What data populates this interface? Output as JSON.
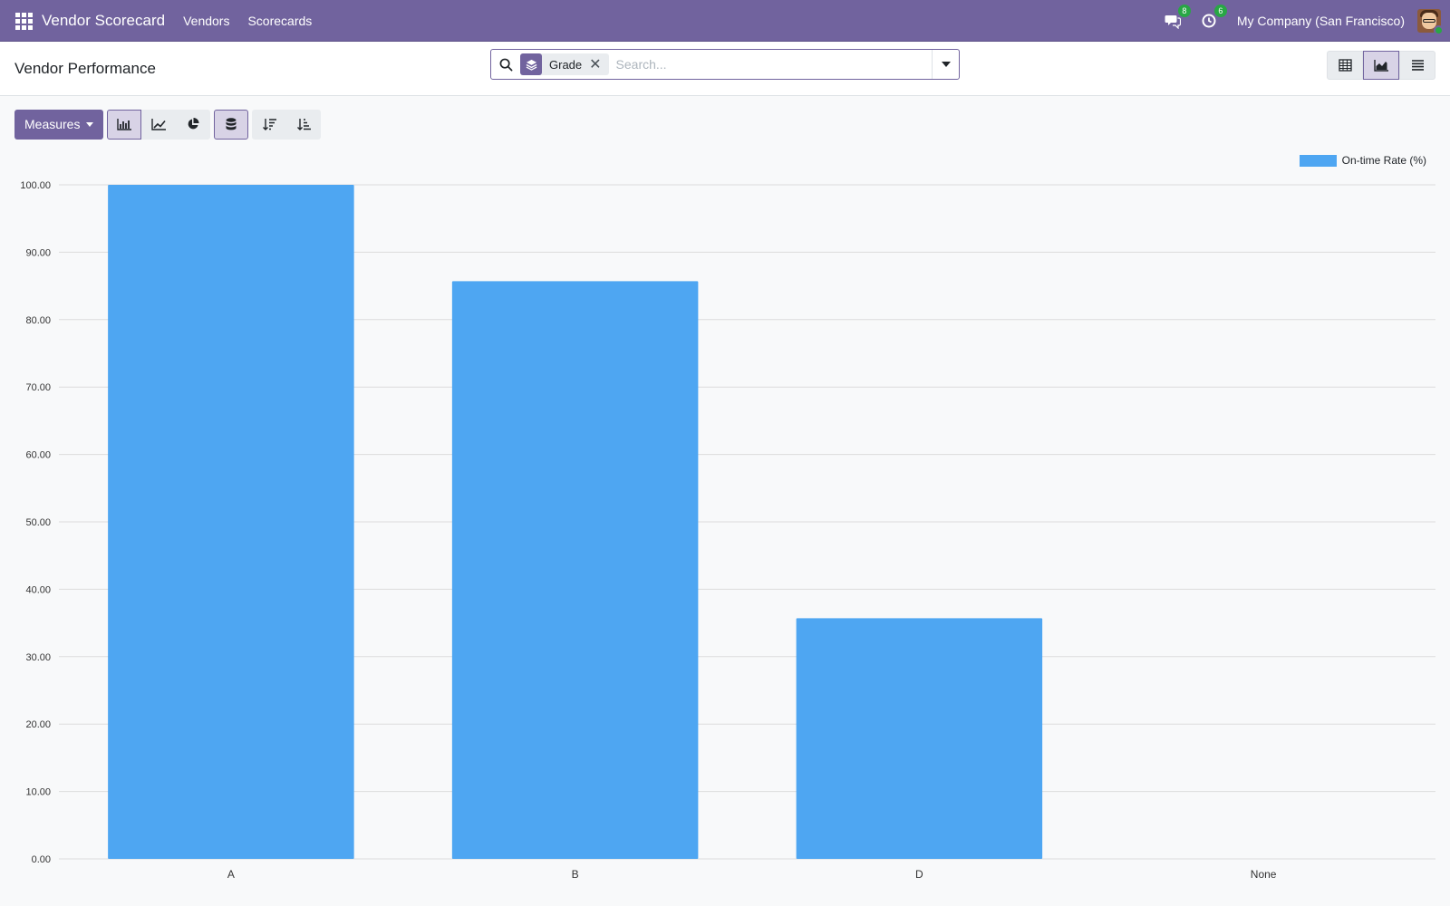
{
  "navbar": {
    "brand": "Vendor Scorecard",
    "menu": [
      "Vendors",
      "Scorecards"
    ],
    "messages_count": "8",
    "activities_count": "6",
    "company": "My Company (San Francisco)"
  },
  "control_panel": {
    "title": "Vendor Performance",
    "facet_label": "Grade",
    "search_placeholder": "Search...",
    "view_icons": [
      "pivot-view-icon",
      "graph-view-icon",
      "list-view-icon"
    ]
  },
  "toolbar": {
    "measures_label": "Measures"
  },
  "colors": {
    "brand": "#71639e",
    "bar": "#4ea6f2"
  },
  "chart_data": {
    "type": "bar",
    "categories": [
      "A",
      "B",
      "D",
      "None"
    ],
    "series": [
      {
        "name": "On-time Rate (%)",
        "values": [
          100.0,
          85.7,
          35.7,
          0.0
        ]
      }
    ],
    "xlabel": "",
    "ylabel": "",
    "ylim": [
      0,
      100
    ],
    "yticks": [
      "0.00",
      "10.00",
      "20.00",
      "30.00",
      "40.00",
      "50.00",
      "60.00",
      "70.00",
      "80.00",
      "90.00",
      "100.00"
    ],
    "grid": true,
    "legend": "top-right"
  }
}
